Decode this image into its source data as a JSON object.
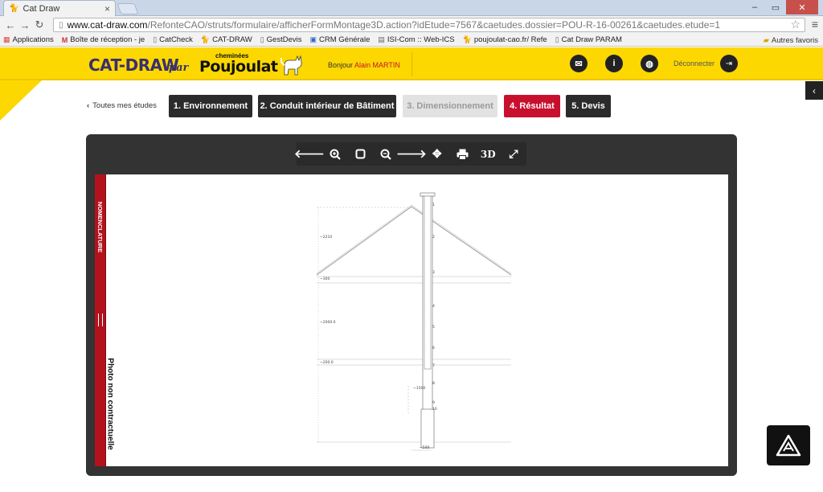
{
  "browser": {
    "tab_title": "Cat Draw",
    "url_domain": "www.cat-draw.com",
    "url_path": "/RefonteCAO/struts/formulaire/afficherFormMontage3D.action?idEtude=7567&caetudes.dossier=POU-R-16-00261&caetudes.etude=1",
    "bookmarks": [
      "Applications",
      "Boîte de réception - je",
      "CatCheck",
      "CAT-DRAW",
      "GestDevis",
      "CRM Générale",
      "ISI-Com :: Web-ICS",
      "poujoulat-cao.fr/ Refe",
      "Cat Draw PARAM"
    ],
    "bookmarks_other": "Autres favoris"
  },
  "header": {
    "brand": "CAT-DRAW",
    "brand_par": "par",
    "partner_small": "cheminées",
    "partner": "Poujoulat",
    "greeting": "Bonjour",
    "user": "Alain MARTIN",
    "logout": "Déconnecter"
  },
  "nav": {
    "back": "Toutes mes études",
    "steps": [
      {
        "label": "1. Environnement",
        "state": "done"
      },
      {
        "label": "2. Conduit intérieur de Bâtiment",
        "state": "done"
      },
      {
        "label": "3. Dimensionnement",
        "state": "disabled"
      },
      {
        "label": "4. Résultat",
        "state": "active"
      },
      {
        "label": "5. Devis",
        "state": "done"
      }
    ]
  },
  "viewer": {
    "tools": [
      "arrow-left-icon",
      "zoom-in-icon",
      "fit-square-icon",
      "zoom-out-icon",
      "arrow-right-icon",
      "move-icon",
      "print-icon",
      "3d-view-icon",
      "fullscreen-icon"
    ],
    "tool_3d_label": "3D",
    "nomenclature": "NOMENCLATURE",
    "photo_note": "Photo non contractuelle",
    "drawing": {
      "dims": [
        "~2210",
        "~300",
        "~2000.0",
        "~200.0",
        "~1500",
        "~500"
      ],
      "part_numbers": [
        "1",
        "2",
        "3",
        "4",
        "5",
        "6",
        "7",
        "8",
        "9",
        "10"
      ]
    }
  },
  "colors": {
    "brand_yellow": "#fcd800",
    "accent_red": "#c8102e",
    "dark": "#2b2b2b"
  }
}
